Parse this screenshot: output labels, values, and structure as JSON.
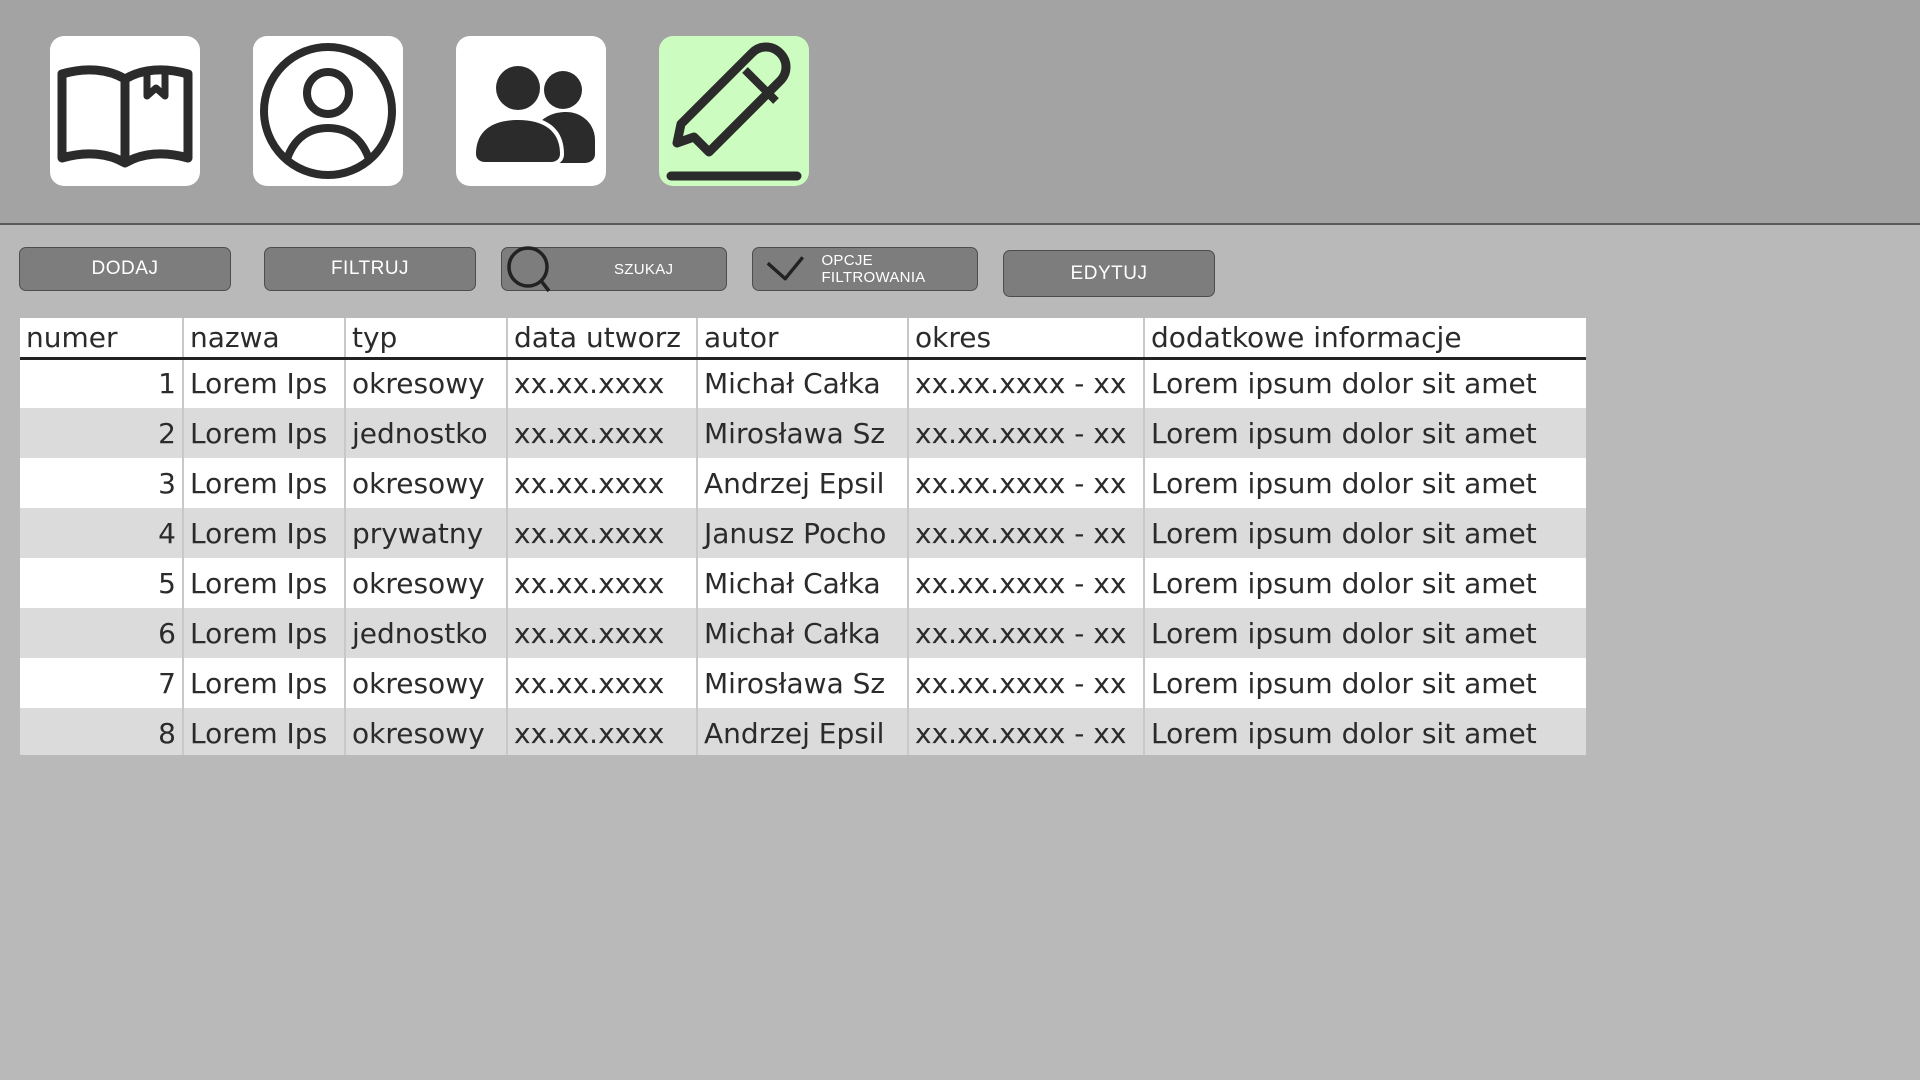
{
  "nav": {
    "tiles": [
      {
        "icon": "book-icon",
        "active": false
      },
      {
        "icon": "user-circle-icon",
        "active": false
      },
      {
        "icon": "users-icon",
        "active": false
      },
      {
        "icon": "pencil-icon",
        "active": true
      }
    ],
    "colors": {
      "tile": "#ffffff",
      "active_tile": "#ccfcc0",
      "icon": "#2b2b2b"
    }
  },
  "toolbar": {
    "add_label": "DODAJ",
    "filter_label": "FILTRUJ",
    "search_label": "SZUKAJ",
    "filter_options_label": "OPCJE FILTROWANIA",
    "edit_label": "EDYTUJ"
  },
  "table": {
    "columns": [
      "numer",
      "nazwa",
      "typ",
      "data utworz",
      "autor",
      "okres",
      "dodatkowe informacje"
    ],
    "rows": [
      [
        "1",
        "Lorem Ips",
        "okresowy",
        "xx.xx.xxxx",
        "Michał Całka",
        "xx.xx.xxxx - xx",
        "Lorem ipsum dolor sit amet"
      ],
      [
        "2",
        "Lorem Ips",
        "jednostko",
        "xx.xx.xxxx",
        "Mirosława Sz",
        "xx.xx.xxxx - xx",
        "Lorem ipsum dolor sit amet"
      ],
      [
        "3",
        "Lorem Ips",
        "okresowy",
        "xx.xx.xxxx",
        "Andrzej Epsil",
        "xx.xx.xxxx - xx",
        "Lorem ipsum dolor sit amet"
      ],
      [
        "4",
        "Lorem Ips",
        "prywatny",
        "xx.xx.xxxx",
        "Janusz Pocho",
        "xx.xx.xxxx - xx",
        "Lorem ipsum dolor sit amet"
      ],
      [
        "5",
        "Lorem Ips",
        "okresowy",
        "xx.xx.xxxx",
        "Michał Całka",
        "xx.xx.xxxx - xx",
        "Lorem ipsum dolor sit amet"
      ],
      [
        "6",
        "Lorem Ips",
        "jednostko",
        "xx.xx.xxxx",
        "Michał Całka",
        "xx.xx.xxxx - xx",
        "Lorem ipsum dolor sit amet"
      ],
      [
        "7",
        "Lorem Ips",
        "okresowy",
        "xx.xx.xxxx",
        "Mirosława Sz",
        "xx.xx.xxxx - xx",
        "Lorem ipsum dolor sit amet"
      ],
      [
        "8",
        "Lorem Ips",
        "okresowy",
        "xx.xx.xxxx",
        "Andrzej Epsil",
        "xx.xx.xxxx - xx",
        "Lorem ipsum dolor sit amet"
      ]
    ]
  }
}
